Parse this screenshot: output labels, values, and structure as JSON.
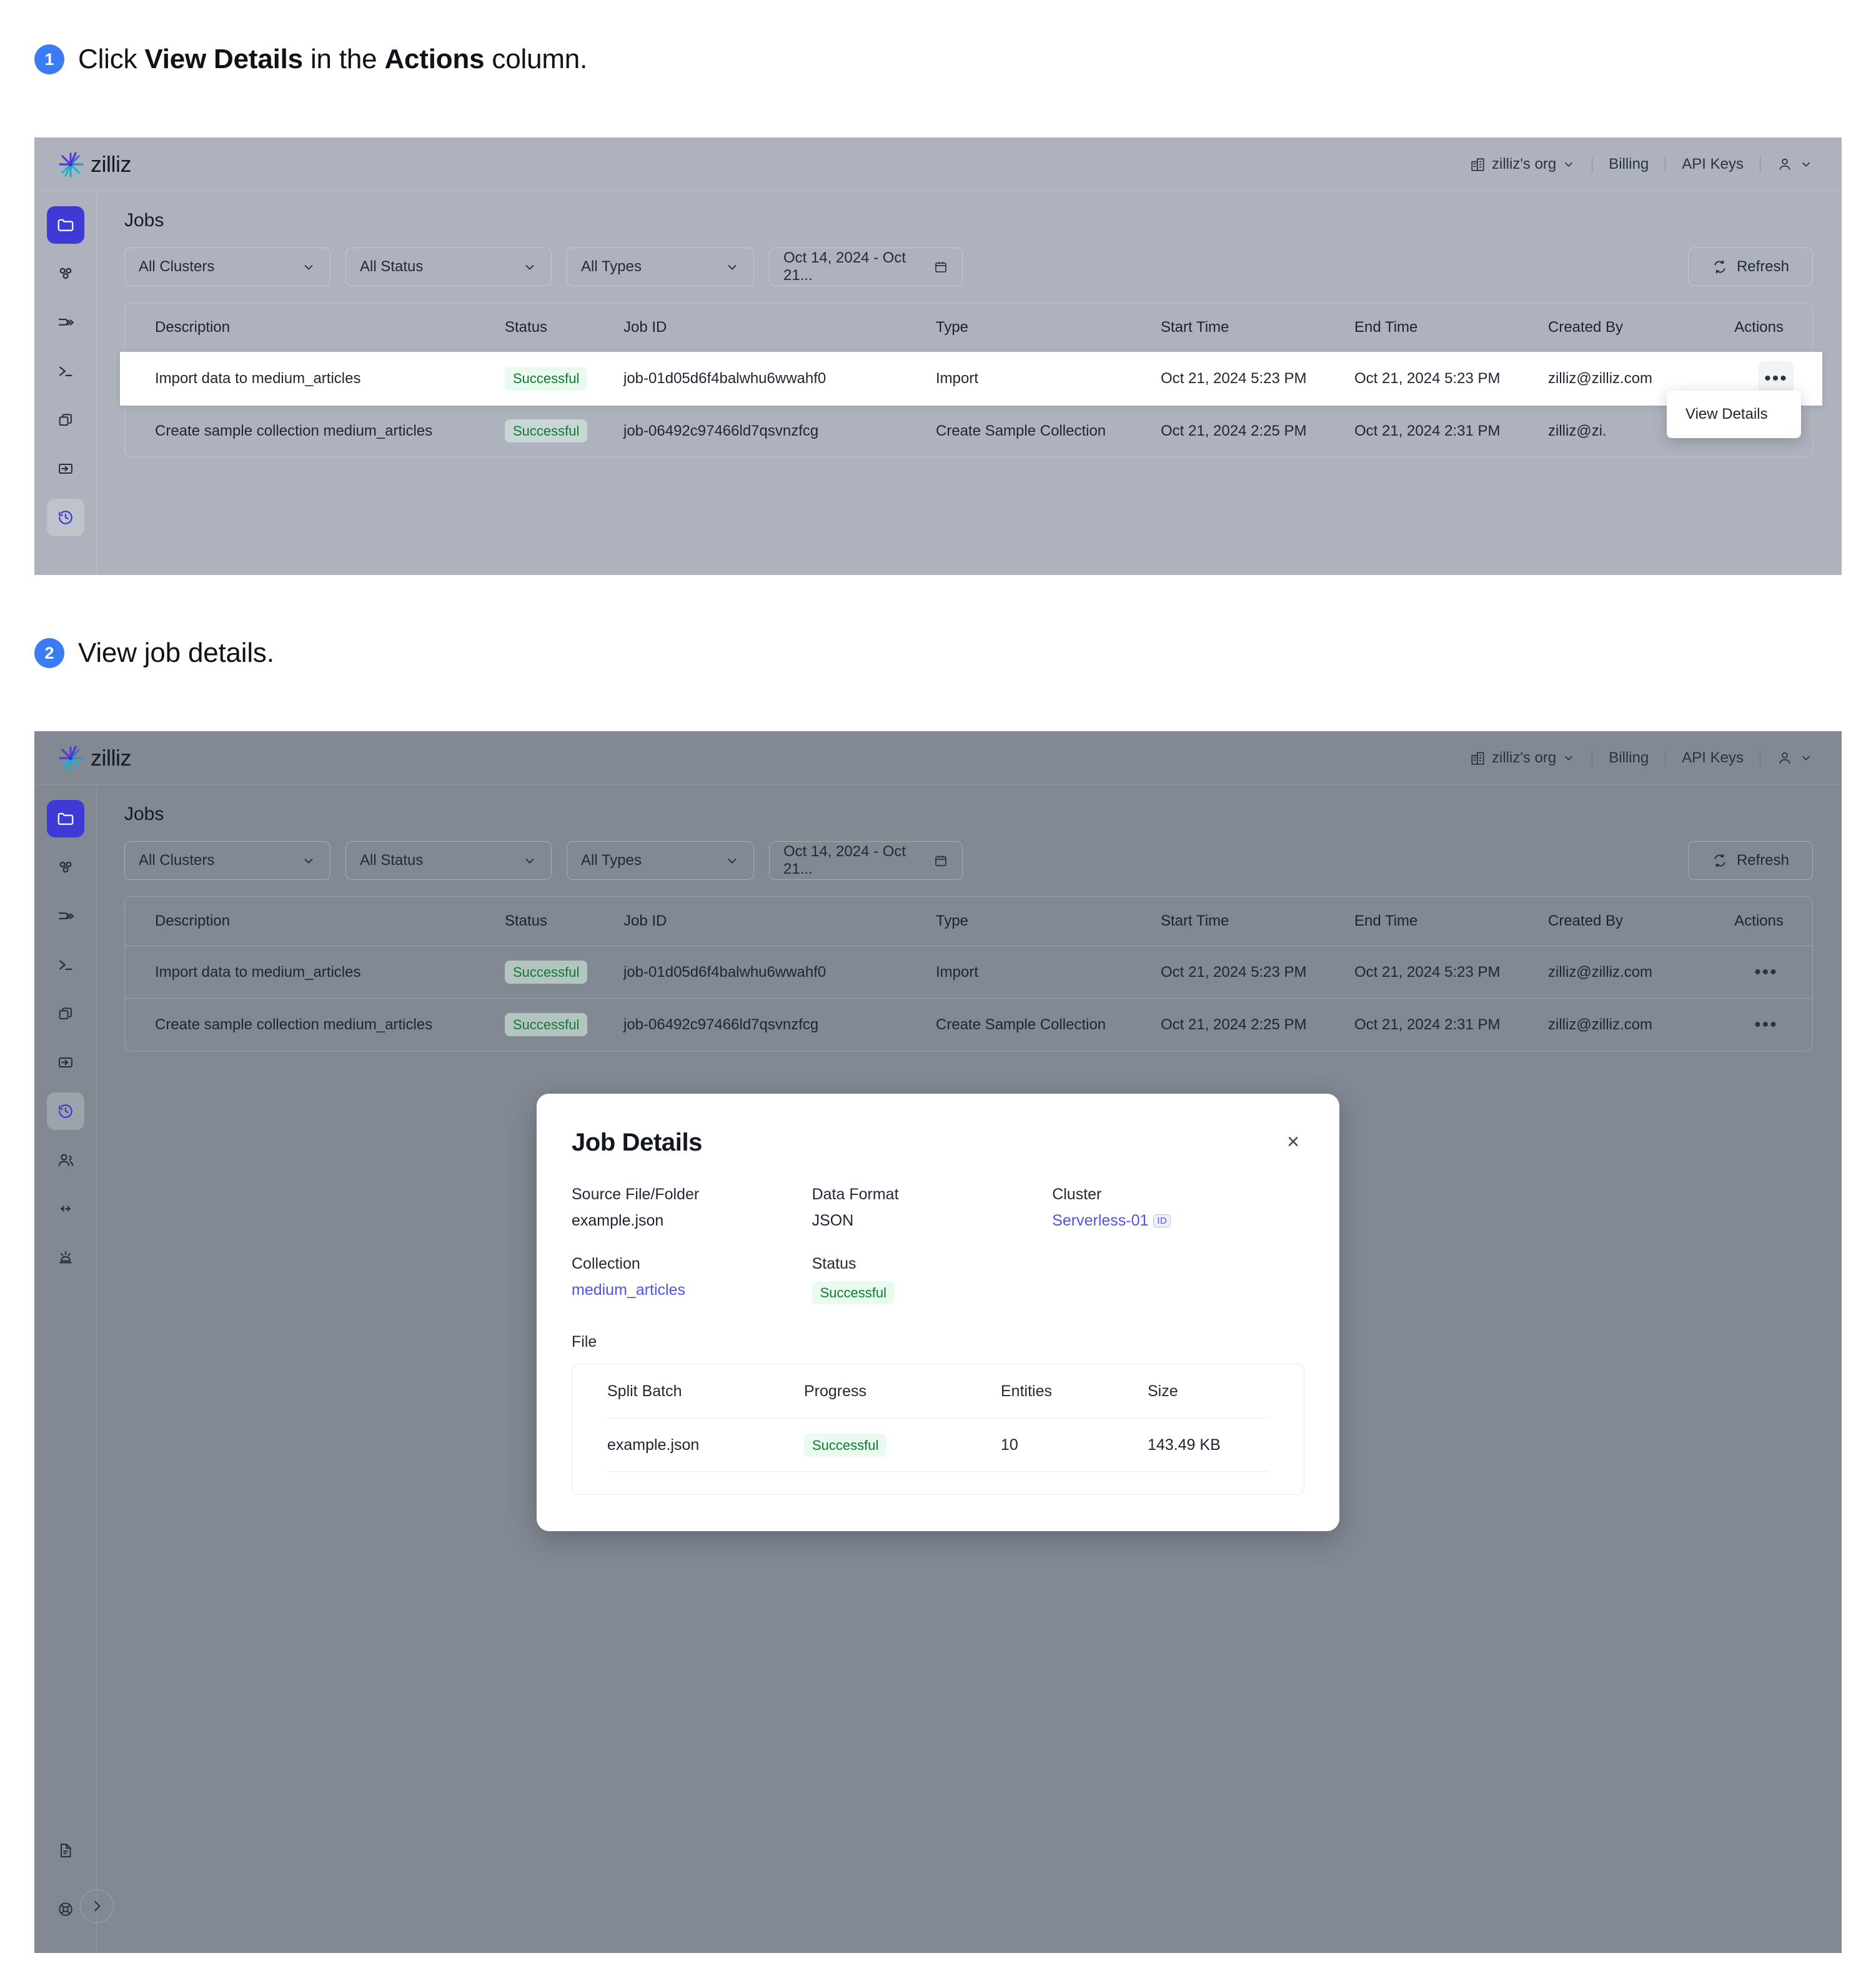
{
  "steps": [
    {
      "num": "1",
      "pre": "Click ",
      "b1": "View Details",
      "mid": " in the ",
      "b2": "Actions",
      "post": " column."
    },
    {
      "num": "2",
      "pre": "View job details.",
      "b1": "",
      "mid": "",
      "b2": "",
      "post": ""
    }
  ],
  "app": {
    "brand": "zilliz",
    "topnav": {
      "org": "zilliz's org",
      "billing": "Billing",
      "api_keys": "API Keys"
    },
    "page_title": "Jobs",
    "filters": {
      "clusters": "All Clusters",
      "status": "All Status",
      "types": "All Types",
      "date_range": "Oct 14, 2024 - Oct 21...",
      "refresh": "Refresh"
    },
    "table": {
      "columns": [
        "Description",
        "Status",
        "Job ID",
        "Type",
        "Start Time",
        "End Time",
        "Created By",
        "Actions"
      ],
      "rows": [
        {
          "description": "Import data to medium_articles",
          "status": "Successful",
          "job_id": "job-01d05d6f4balwhu6wwahf0",
          "type": "Import",
          "start_time": "Oct 21, 2024 5:23 PM",
          "end_time": "Oct 21, 2024 5:23 PM",
          "created_by": "zilliz@zilliz.com",
          "actions": "•••"
        },
        {
          "description": "Create sample collection medium_articles",
          "status": "Successful",
          "job_id": "job-06492c97466ld7qsvnzfcg",
          "type": "Create Sample Collection",
          "start_time": "Oct 21, 2024 2:25 PM",
          "end_time": "Oct 21, 2024 2:31 PM",
          "created_by": "zilliz@zilliz.com",
          "created_by_clipped": "zilliz@zi.",
          "actions": "•••"
        }
      ]
    },
    "context_menu": {
      "view_details": "View Details"
    },
    "sidebar": {
      "items": [
        {
          "name": "folder-icon",
          "label": "Databases"
        },
        {
          "name": "cluster-icon",
          "label": "Clusters"
        },
        {
          "name": "pipeline-icon",
          "label": "Pipelines"
        },
        {
          "name": "terminal-icon",
          "label": "Console"
        },
        {
          "name": "copy-icon",
          "label": "Backups"
        },
        {
          "name": "import-icon",
          "label": "Import"
        },
        {
          "name": "history-clock-icon",
          "label": "Jobs"
        },
        {
          "name": "users-icon",
          "label": "Users"
        },
        {
          "name": "connect-icon",
          "label": "Connect"
        },
        {
          "name": "lab-icon",
          "label": "Lab"
        }
      ],
      "bottom": [
        {
          "name": "document-icon",
          "label": "Docs"
        },
        {
          "name": "life-ring-icon",
          "label": "Support"
        }
      ],
      "expand": {
        "name": "chevron-right-icon",
        "label": "Expand"
      }
    }
  },
  "modal": {
    "title": "Job Details",
    "close": "×",
    "fields": {
      "source_label": "Source File/Folder",
      "source_value": "example.json",
      "format_label": "Data Format",
      "format_value": "JSON",
      "cluster_label": "Cluster",
      "cluster_value": "Serverless-01",
      "cluster_id_chip": "ID",
      "collection_label": "Collection",
      "collection_value": "medium_articles",
      "status_label": "Status",
      "status_value": "Successful"
    },
    "file_section_label": "File",
    "file_table": {
      "columns": [
        "Split Batch",
        "Progress",
        "Entities",
        "Size"
      ],
      "rows": [
        {
          "split_batch": "example.json",
          "progress": "Successful",
          "entities": "10",
          "size": "143.49 KB"
        }
      ]
    }
  },
  "colors": {
    "accent_blue": "#3b7cf6",
    "brand_indigo": "#3f3ad6",
    "link": "#4f54e8",
    "success_text": "#0e7a35",
    "success_bg": "#e9fbef",
    "panel1_bg": "#aeb2bc",
    "panel2_bg": "#828992"
  }
}
